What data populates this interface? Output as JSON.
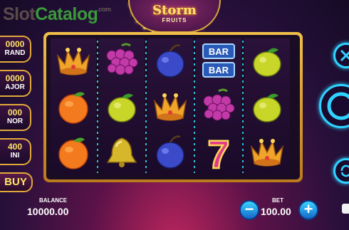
{
  "watermark": {
    "part1": "Slot",
    "part2": "Catalog",
    "suffix": ".com"
  },
  "logo": {
    "title": "Storm",
    "subtitle": "FRUITS"
  },
  "jackpots": [
    {
      "value": "0000",
      "label": "RAND"
    },
    {
      "value": "0000",
      "label": "AJOR"
    },
    {
      "value": "000",
      "label": "NOR"
    },
    {
      "value": "400",
      "label": "INI"
    }
  ],
  "buy_label": "BUY",
  "balance": {
    "label": "BALANCE",
    "value": "10000.00"
  },
  "bet": {
    "label": "BET",
    "value": "100.00",
    "minus": "−",
    "plus": "+"
  },
  "reels": [
    [
      "crown-icon",
      "orange-icon",
      "orange-icon"
    ],
    [
      "grapes-icon",
      "lemon-icon",
      "bell-icon"
    ],
    [
      "plum-icon",
      "crown-icon",
      "plum-icon"
    ],
    [
      "double-bar-icon",
      "grapes-icon",
      "seven-icon"
    ],
    [
      "lemon-icon",
      "lemon-icon",
      "crown-icon"
    ]
  ],
  "bar_text": "BAR",
  "seven_text": "7"
}
